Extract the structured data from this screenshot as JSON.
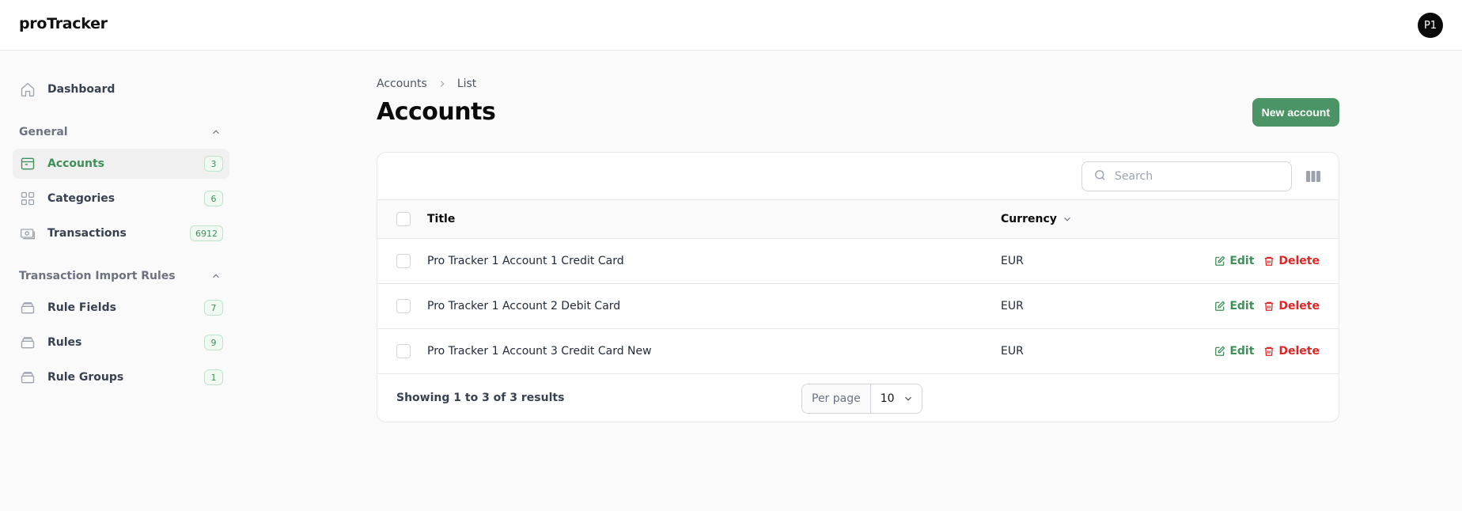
{
  "app": {
    "brand": "proTracker",
    "avatar_initials": "P1"
  },
  "sidebar": {
    "dashboard": {
      "label": "Dashboard",
      "icon": "home-icon"
    },
    "groups": [
      {
        "label": "General",
        "items": [
          {
            "label": "Accounts",
            "count": "3",
            "icon": "wallet-icon",
            "active": true
          },
          {
            "label": "Categories",
            "count": "6",
            "icon": "grid-icon",
            "active": false
          },
          {
            "label": "Transactions",
            "count": "6912",
            "icon": "banknote-icon",
            "active": false
          }
        ]
      },
      {
        "label": "Transaction Import Rules",
        "items": [
          {
            "label": "Rule Fields",
            "count": "7",
            "icon": "stack-icon",
            "active": false
          },
          {
            "label": "Rules",
            "count": "9",
            "icon": "stack-icon",
            "active": false
          },
          {
            "label": "Rule Groups",
            "count": "1",
            "icon": "stack-icon",
            "active": false
          }
        ]
      }
    ]
  },
  "breadcrumb": [
    "Accounts",
    "List"
  ],
  "page": {
    "title": "Accounts",
    "new_button": "New account"
  },
  "table": {
    "search_placeholder": "Search",
    "columns": {
      "title": "Title",
      "currency": "Currency"
    },
    "rows": [
      {
        "title": "Pro Tracker 1 Account 1 Credit Card",
        "currency": "EUR"
      },
      {
        "title": "Pro Tracker 1 Account 2 Debit Card",
        "currency": "EUR"
      },
      {
        "title": "Pro Tracker 1 Account 3 Credit Card New",
        "currency": "EUR"
      }
    ],
    "actions": {
      "edit": "Edit",
      "delete": "Delete"
    },
    "results_text": "Showing 1 to 3 of 3 results",
    "per_page_label": "Per page",
    "per_page_value": "10"
  },
  "colors": {
    "accent": "#4a9466",
    "danger": "#dc2626"
  }
}
